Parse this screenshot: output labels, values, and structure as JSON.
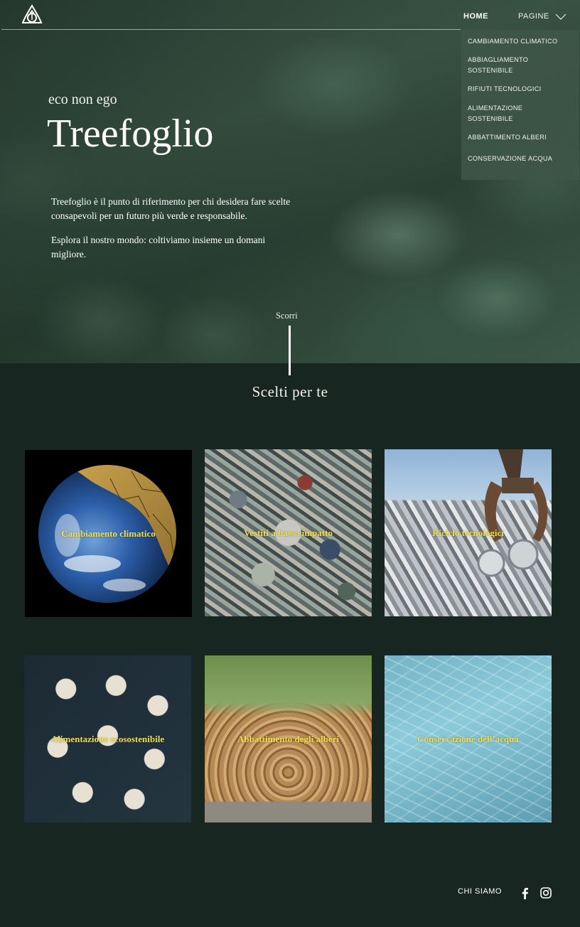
{
  "header": {
    "logo_icon": "triquetra-tree-logo-icon",
    "nav": {
      "home": "HOME",
      "pagine": "PAGINE",
      "pagine_icon": "chevron-down-icon"
    },
    "dropdown": [
      "CAMBIAMENTO CLIMATICO",
      "ABBIAGLIAMENTO SOSTENIBILE",
      "RIFIUTI TECNOLOGICI",
      "ALIMENTAZIONE SOSTENIBILE",
      "ABBATTIMENTO ALBERI",
      "CONSERVAZIONE ACQUA"
    ]
  },
  "hero": {
    "tagline": "eco non ego",
    "brand": "Treefoglio",
    "description": [
      "Treefoglio è il punto di riferimento per chi desidera fare scelte consapevoli per un futuro più verde e responsabile.",
      "Esplora il nostro mondo: coltiviamo insieme un domani migliore."
    ],
    "scroll_label": "Scorri"
  },
  "section": {
    "title": "Scelti per te",
    "cards": [
      "Cambiamento climatico",
      "Vestiti a basso impatto",
      "Riciclo tecnologici",
      "Alimentazione ecosostenibile",
      "Abbattimento degli alberi",
      "Conservazione dell’acqua"
    ]
  },
  "footer": {
    "chi_siamo": "CHI SIAMO",
    "facebook_icon": "facebook-icon",
    "instagram_icon": "instagram-icon"
  },
  "colors": {
    "background": "#172620",
    "card_label": "#f2df4a",
    "dropdown_bg": "#3e5648"
  }
}
